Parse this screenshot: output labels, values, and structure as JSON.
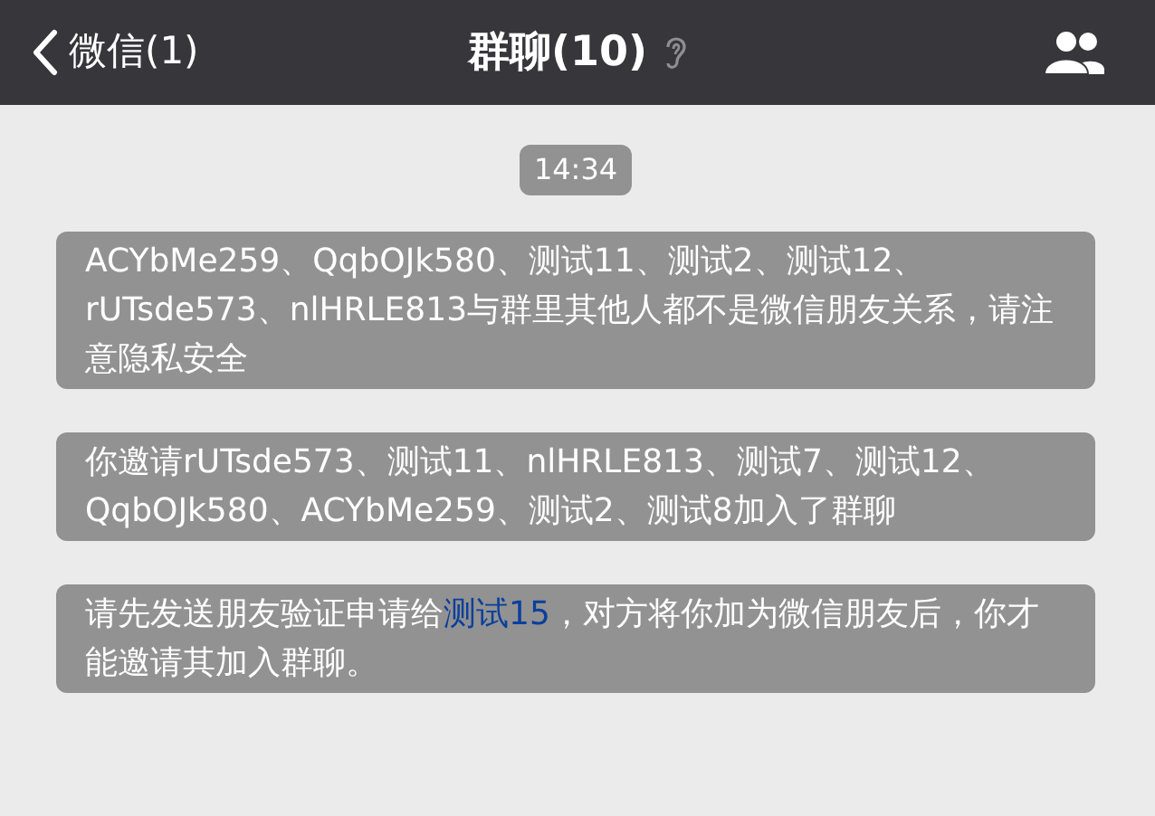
{
  "nav": {
    "back_label": "微信(1)",
    "title": "群聊(10)",
    "earpiece_mode": true
  },
  "messages": [
    {
      "kind": "time",
      "parts": [
        {
          "kind": "text",
          "text": "14:34"
        }
      ]
    },
    {
      "kind": "system",
      "parts": [
        {
          "kind": "text",
          "text": "ACYbMe259、QqbOJk580、测试11、测试2、测试12、rUTsde573、nlHRLE813与群里其他人都不是微信朋友关系，请注意隐私安全"
        }
      ]
    },
    {
      "kind": "system",
      "parts": [
        {
          "kind": "text",
          "text": "你邀请rUTsde573、测试11、nlHRLE813、测试7、测试12、QqbOJk580、ACYbMe259、测试2、测试8加入了群聊"
        }
      ]
    },
    {
      "kind": "system",
      "parts": [
        {
          "kind": "text",
          "text": "请先发送朋友验证申请给"
        },
        {
          "kind": "link",
          "text": "测试15"
        },
        {
          "kind": "text",
          "text": "，对方将你加为微信朋友后，你才能邀请其加入群聊。"
        }
      ]
    }
  ]
}
